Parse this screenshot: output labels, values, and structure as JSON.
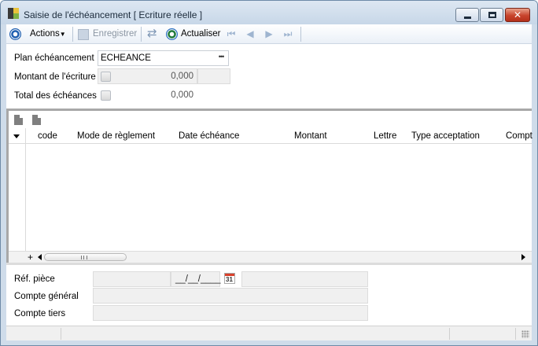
{
  "window": {
    "title": "Saisie de l'échéancement [ Ecriture réelle ]"
  },
  "toolbar": {
    "actions_label": "Actions",
    "enregistrer_label": "Enregistrer",
    "actualiser_label": "Actualiser"
  },
  "form": {
    "plan_label": "Plan échéancement",
    "plan_value": "ECHEANCE",
    "montant_label": "Montant de l'écriture",
    "montant_value": "0,000",
    "total_label": "Total des échéances",
    "total_value": "0,000"
  },
  "grid": {
    "columns": [
      "code",
      "Mode de règlement",
      "Date échéance",
      "Montant",
      "Lettre",
      "Type acceptation",
      "Compt"
    ]
  },
  "bottom": {
    "ref_label": "Réf. pièce",
    "date_placeholder": "__/__/____",
    "calendar_day": "31",
    "compte_general_label": "Compte général",
    "compte_tiers_label": "Compte tiers"
  }
}
